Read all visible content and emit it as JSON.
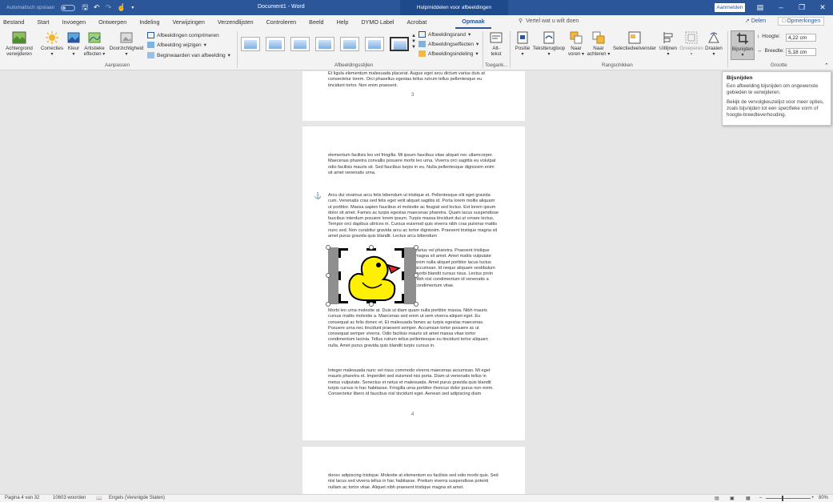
{
  "titlebar": {
    "autosave": "Automatisch opslaan",
    "doc_title": "Document1 - Word",
    "context_title": "Hulpmiddelen voor afbeeldingen",
    "signin": "Aanmelden"
  },
  "tabs": [
    "Bestand",
    "Start",
    "Invoegen",
    "Ontwerpen",
    "Indeling",
    "Verwijzingen",
    "Verzendlijsten",
    "Controleren",
    "Beeld",
    "Help",
    "DYMO Label",
    "Acrobat",
    "Opmaak"
  ],
  "active_tab": "Opmaak",
  "tell_me": "Vertel wat u wilt doen",
  "share": "Delen",
  "comments": "Opmerkingen",
  "ribbon": {
    "adjust": {
      "remove_bg": [
        "Achtergrond",
        "verwijderen"
      ],
      "corrections": "Correcties",
      "color": "Kleur",
      "artistic": [
        "Artistieke",
        "effecten"
      ],
      "transparency": "Doorzichtigheid",
      "compress": "Afbeeldingen comprimeren",
      "change": "Afbeelding wijzigen",
      "reset": "Beginwaarden van afbeelding",
      "group_label": "Aanpassen"
    },
    "styles": {
      "border": "Afbeeldingsrand",
      "effects": "Afbeeldingseffecten",
      "layout": "Afbeeldingsindeling",
      "group_label": "Afbeeldingsstijlen"
    },
    "access": {
      "alt_text": [
        "Alt-",
        "tekst"
      ],
      "group_label": "Toegank..."
    },
    "arrange": {
      "position": "Positie",
      "wrap": "Tekstterugloop",
      "forward": [
        "Naar",
        "voren"
      ],
      "backward": [
        "Naar",
        "achteren"
      ],
      "selection_pane": "Selectiedeelvenster",
      "align": "Uitlijnen",
      "group": "Groeperen",
      "rotate": "Draaien",
      "group_label": "Rangschikken"
    },
    "size": {
      "crop": "Bijsnijden",
      "height_label": "Hoogte:",
      "height_value": "4,22 cm",
      "width_label": "Breedte:",
      "width_value": "5,18 cm",
      "group_label": "Grootte"
    }
  },
  "tooltip": {
    "title": "Bijsnijden",
    "line1": "Een afbeelding bijsnijden om ongewenste gebieden te verwijderen.",
    "line2": "Bekijk de vervolgkeuzelijst voor meer opties, zoals bijsnijden tot een specifieke vorm of hoogte-breedteverhouding."
  },
  "pages": {
    "p3_text": "Et ligula elementum malesuada placerat. Augue eget arcu dictum varius duis at consectetur lorem. Orci phasellus egestas tellus rutrum tellus pellentesque eu tincidunt tortor. Non enim praesent.",
    "p3_num": "3",
    "p4_para1": "elementum facilisis leo vel fringilla. Mi ipsum faucibus vitae aliquet nec ullamcorper. Maecenas pharetra convallis posuere morbi leo urna. Viverra orci sagittis eu volutpat odio facilisis mauris sit. Sed faucibus turpis in eu. Nulla pellentesque dignissim enim sit amet venenatis urna.",
    "p4_para2": "Arcu dui vivamus arcu felis bibendum ut tristique et. Pellentesque elit eget gravida cum. Venenatis cras sed felis eget velit aliquet sagittis id. Porta lorem mollis aliquam ut porttitor. Massa sapien faucibus et molestie ac feugiat sed lectus. Est lorem ipsum dolor sit amet. Fames ac turpis egestas maecenas pharetra. Quam lacus suspendisse faucibus interdum posuere lorem ipsum. Turpis massa tincidunt dui ut ornare lectus. Tempor orci dapibus ultrices in. Cursus euismod quis viverra nibh cras pulvinar mattis nunc sed. Non curabitur gravida arcu ac tortor dignissim. Praesent tristique magna sit amet purus gravida quis blandit. Lectus arcu bibendum",
    "p4_wrap": "varius vel pharetra. Praesent tristique magna sit amet. Amet mattis vulputate enim nulla aliquet porttitor lacus luctus accumsan. Id neque aliquam vestibulum morbi blandit cursus risus. Lectus proin nibh nisl condimentum id venenatis a condimentum vitae.",
    "p4_para3": "Morbi leo urna molestie at. Duis ut diam quam nulla porttitor massa. Nibh mauris cursus mattis molestie a. Maecenas sed enim ut sem viverra aliquet eget. Eu consequat ac felis donec et. Et malesuada fames ac turpis egestas maecenas. Posuere urna nec tincidunt praesent semper. Accumsan tortor posuere ac ut consequat semper viverra. Odio facilisis mauris sit amet massa vitae tortor condimentum lacinia. Tellus rutrum tellus pellentesque eu tincidunt tortor aliquam nulla. Amet purus gravida quis blandit turpis cursus in.",
    "p4_para4": "Integer malesuada nunc vel risus commodo viverra maecenas accumsan. Mi eget mauris pharetra et. Imperdiet sed euismod nisi porta. Diam ut venenatis tellus in metus vulputate. Senectus et netus et malesuada. Amet purus gravida quis blandit turpis cursus in hac habitasse. Fringilla urna porttitor rhoncus dolor purus non enim. Consectetur libero id faucibus nisl tincidunt eget. Aenean sed adipiscing diam",
    "p4_num": "4",
    "p5_text": "donec adipiscing tristique. Molestie at elementum eu facilisis sed odio morbi quis. Sed nisi lacus sed viverra tellus in hac habitasse. Pretium viverra suspendisse potenti nullam ac tortor vitae. Aliquet nibh praesent tristique magna sit amet."
  },
  "statusbar": {
    "page": "Pagina 4 van 32",
    "words": "10603 woorden",
    "language": "Engels (Verenigde Staten)",
    "zoom": "80%"
  },
  "colors": {
    "word_blue": "#2b579a",
    "duck_yellow": "#ffef00",
    "beak_red": "#e8202a"
  }
}
